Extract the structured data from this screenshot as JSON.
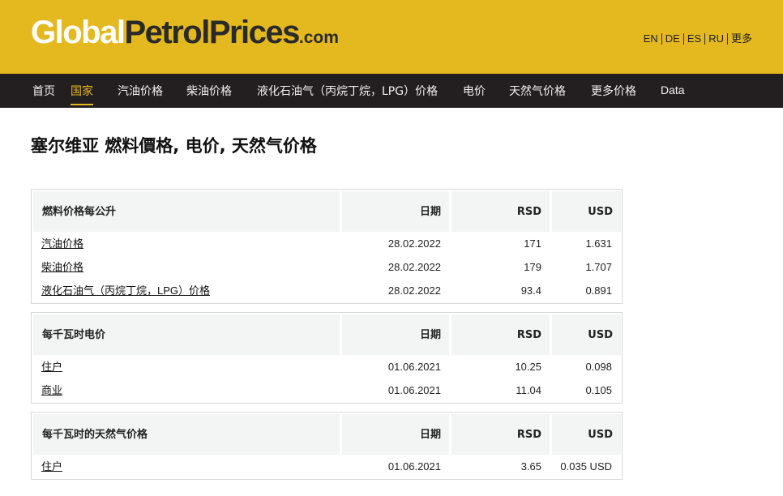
{
  "header": {
    "logo": {
      "part1": "Global",
      "part2": "PetrolPrices",
      "part3": ".com"
    },
    "languages": [
      "EN",
      "DE",
      "ES",
      "RU",
      "更多"
    ]
  },
  "nav": {
    "items": [
      {
        "label": "首页"
      },
      {
        "label": "国家"
      },
      {
        "label": "汽油价格"
      },
      {
        "label": "柴油价格"
      },
      {
        "label": "液化石油气（丙烷丁烷，LPG）价格"
      },
      {
        "label": "电价"
      },
      {
        "label": "天然气价格"
      },
      {
        "label": "更多价格"
      },
      {
        "label": "Data"
      }
    ]
  },
  "page": {
    "title": "塞尔维亚 燃料價格, 电价, 天然气价格"
  },
  "tables": [
    {
      "headers": [
        "燃料价格每公升",
        "日期",
        "RSD",
        "USD"
      ],
      "rows": [
        [
          "汽油价格",
          "28.02.2022",
          "171",
          "1.631"
        ],
        [
          "柴油价格",
          "28.02.2022",
          "179",
          "1.707"
        ],
        [
          "液化石油气（丙烷丁烷，LPG）价格",
          "28.02.2022",
          "93.4",
          "0.891"
        ]
      ]
    },
    {
      "headers": [
        "每千瓦时电价",
        "日期",
        "RSD",
        "USD"
      ],
      "rows": [
        [
          "住户",
          "01.06.2021",
          "10.25",
          "0.098"
        ],
        [
          "商业",
          "01.06.2021",
          "11.04",
          "0.105"
        ]
      ]
    },
    {
      "headers": [
        "每千瓦时的天然气价格",
        "日期",
        "RSD",
        "USD"
      ],
      "rows": [
        [
          "住户",
          "01.06.2021",
          "3.65",
          "0.035 USD"
        ]
      ]
    }
  ]
}
